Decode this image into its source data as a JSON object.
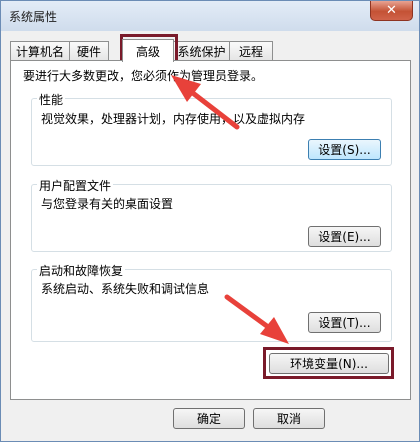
{
  "window": {
    "title": "系统属性",
    "close_glyph": "✕"
  },
  "tabs": [
    {
      "label": "计算机名"
    },
    {
      "label": "硬件"
    },
    {
      "label": "高级",
      "active": true
    },
    {
      "label": "系统保护"
    },
    {
      "label": "远程"
    }
  ],
  "notice": "要进行大多数更改，您必须作为管理员登录。",
  "groups": {
    "performance": {
      "label": "性能",
      "description": "视觉效果，处理器计划，内存使用，以及虚拟内存",
      "button": "设置(S)..."
    },
    "profiles": {
      "label": "用户配置文件",
      "description": "与您登录有关的桌面设置",
      "button": "设置(E)..."
    },
    "startup": {
      "label": "启动和故障恢复",
      "description": "系统启动、系统失败和调试信息",
      "button": "设置(T)..."
    }
  },
  "env_button": "环境变量(N)...",
  "footer": {
    "ok": "确定",
    "cancel": "取消"
  },
  "annotation": {
    "color": "#e8413a",
    "highlight_color": "#7a1a2a"
  }
}
